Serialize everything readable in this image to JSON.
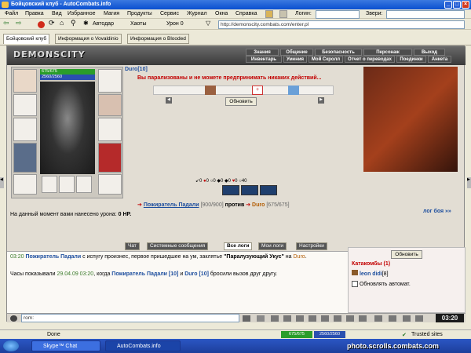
{
  "window": {
    "title": "Бойцовский клуб - AutoCombats.info"
  },
  "menu": [
    "Файл",
    "Правка",
    "Вид",
    "Избранное",
    "Магия",
    "Продукты",
    "Сервис",
    "Журнал",
    "Окна",
    "Справка"
  ],
  "toolbar": {
    "login_label": "Логин:",
    "beasts_label": "Звери:",
    "autodar": "Автодар",
    "haots": "Хаоты",
    "uron": "Урон 0",
    "address": "http://demonscity.combats.com/enter.pl"
  },
  "tabs": [
    "Бойцовский клуб",
    "Информация о Vovaldinio",
    "Информация о Blooded"
  ],
  "game": {
    "logo": "DEMONSCITY",
    "nav_top": [
      "Знания",
      "Общение",
      "Безопасность",
      "Персонаж",
      "Выход"
    ],
    "nav_bottom": [
      "Инвентарь",
      "Умения",
      "Мой Скролл",
      "Отчет о переводах",
      "Поединки",
      "Анкета"
    ],
    "player": {
      "hp": "675/675",
      "mana": "2560/2560",
      "name": "Duro",
      "level": "[10]"
    },
    "paralyzed_msg": "Вы парализованы и не можете предпринимать никаких действий...",
    "refresh": "Обновить",
    "stats": [
      "0",
      "0",
      "0",
      "0",
      "0",
      "0",
      "40"
    ],
    "opponent": {
      "name": "Пожиратель Падали",
      "hp": "[900/900]"
    },
    "vs": "против",
    "self_name": "Duro",
    "self_hp": "[675/675]",
    "damage_label": "На данный момент вами нанесено урона:",
    "damage_value": "0 HP.",
    "battle_log_link": "лог боя »»",
    "chat_tabs": [
      "Чат",
      "Системные сообщения",
      "Все логи",
      "Мои логи",
      "Настройки"
    ],
    "chat": {
      "line1_time": "03:20",
      "line1_name": "Пожиратель Падали",
      "line1_text": "с испугу произнес, первое пришедшее на ум, заклятье",
      "line1_spell": "\"Паралузующий Укус\"",
      "line1_on": "на",
      "line1_target": "Duro",
      "line2_a": "Часы показывали",
      "line2_date": "29.04.09 03:20",
      "line2_b": ", когда",
      "line2_n1": "Пожиратель Падали [10]",
      "line2_and": "и",
      "line2_n2": "Duro [10]",
      "line2_c": "бросили вызов друг другу."
    },
    "right": {
      "refresh": "Обновить",
      "catacombs": "Катакомбы (1)",
      "player": "leon didi",
      "player_lvl": "[8]",
      "auto": "Обновлять автомат."
    },
    "bottom": {
      "input": "rom:",
      "clock": "03:20"
    }
  },
  "status": {
    "left": "Done",
    "hp1": "675/675",
    "hp2": "2560/2560",
    "right": "Trusted sites"
  },
  "taskbar": {
    "start": "",
    "items": [
      "Skype™ Chat",
      "AutoCombats.info"
    ],
    "watermark": "photo.scrolls.combats.com"
  }
}
